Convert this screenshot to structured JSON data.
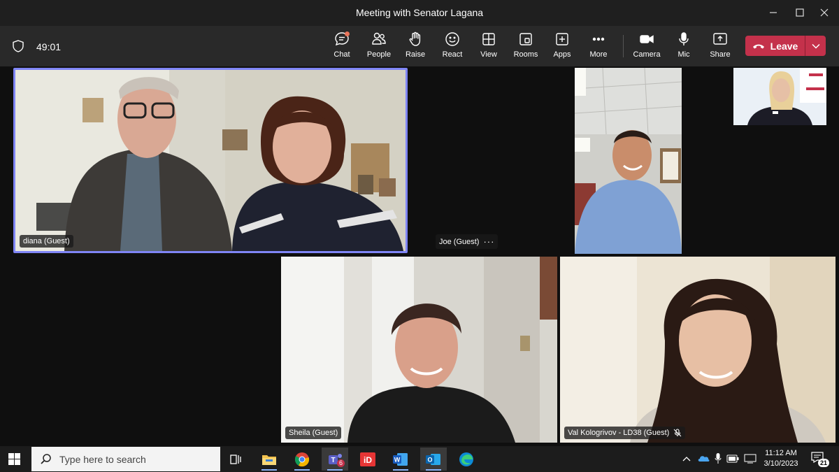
{
  "window": {
    "title": "Meeting with Senator Lagana"
  },
  "toolbar": {
    "timer": "49:01",
    "buttons": [
      {
        "label": "Chat",
        "icon": "chat-icon"
      },
      {
        "label": "People",
        "icon": "people-icon"
      },
      {
        "label": "Raise",
        "icon": "raise-hand-icon"
      },
      {
        "label": "React",
        "icon": "smile-icon"
      },
      {
        "label": "View",
        "icon": "view-grid-icon"
      },
      {
        "label": "Rooms",
        "icon": "rooms-icon"
      },
      {
        "label": "Apps",
        "icon": "apps-plus-icon"
      },
      {
        "label": "More",
        "icon": "more-icon"
      },
      {
        "label": "Camera",
        "icon": "camera-icon"
      },
      {
        "label": "Mic",
        "icon": "mic-icon"
      },
      {
        "label": "Share",
        "icon": "share-icon"
      }
    ],
    "leave_label": "Leave",
    "leave_color": "#c4314b"
  },
  "participants": [
    {
      "name": "diana (Guest)",
      "highlight_color": "#7f85f5"
    },
    {
      "name": "Joe (Guest)"
    },
    {
      "name": "Sheila (Guest)"
    },
    {
      "name": "Val Kologrivov - LD38 (Guest)",
      "muted": true
    }
  ],
  "taskbar": {
    "search_placeholder": "Type here to search",
    "teams_badge": "6",
    "time": "11:12 AM",
    "date": "3/10/2023",
    "notification_count": "21"
  }
}
